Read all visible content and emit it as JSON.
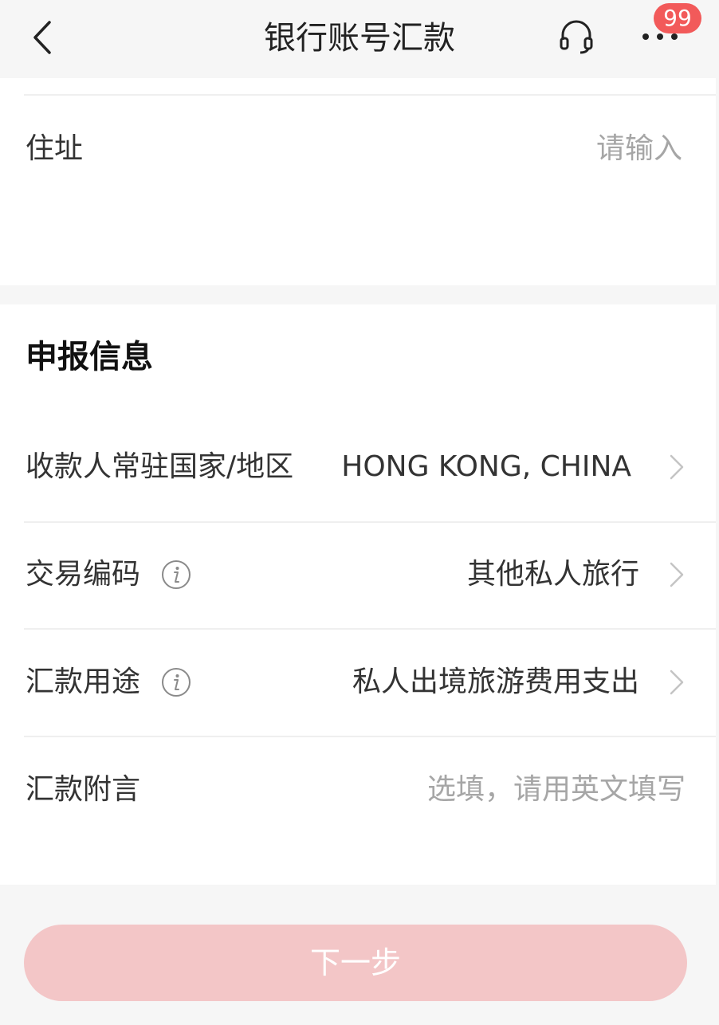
{
  "nav": {
    "title": "银行账号汇款",
    "back_icon": "chevron-left-icon",
    "service_icon": "headset-icon",
    "more_icon": "more-dots-icon",
    "badge_count": "99"
  },
  "address": {
    "label": "住址",
    "placeholder": "请输入"
  },
  "declaration": {
    "title": "申报信息",
    "rows": [
      {
        "label": "收款人常驻国家/地区",
        "value": "HONG KONG, CHINA"
      },
      {
        "label": "交易编码",
        "value": "其他私人旅行",
        "info_icon": "info-icon"
      },
      {
        "label": "汇款用途",
        "value": "私人出境旅游费用支出",
        "info_icon": "info-icon"
      }
    ],
    "remark": {
      "label": "汇款附言",
      "placeholder": "选填，请用英文填写"
    }
  },
  "actions": {
    "next_label": "下一步"
  },
  "colors": {
    "button_disabled": "#f3c6c7",
    "badge": "#f25a5a",
    "placeholder": "#a6a6a6",
    "background": "#f6f6f6"
  }
}
